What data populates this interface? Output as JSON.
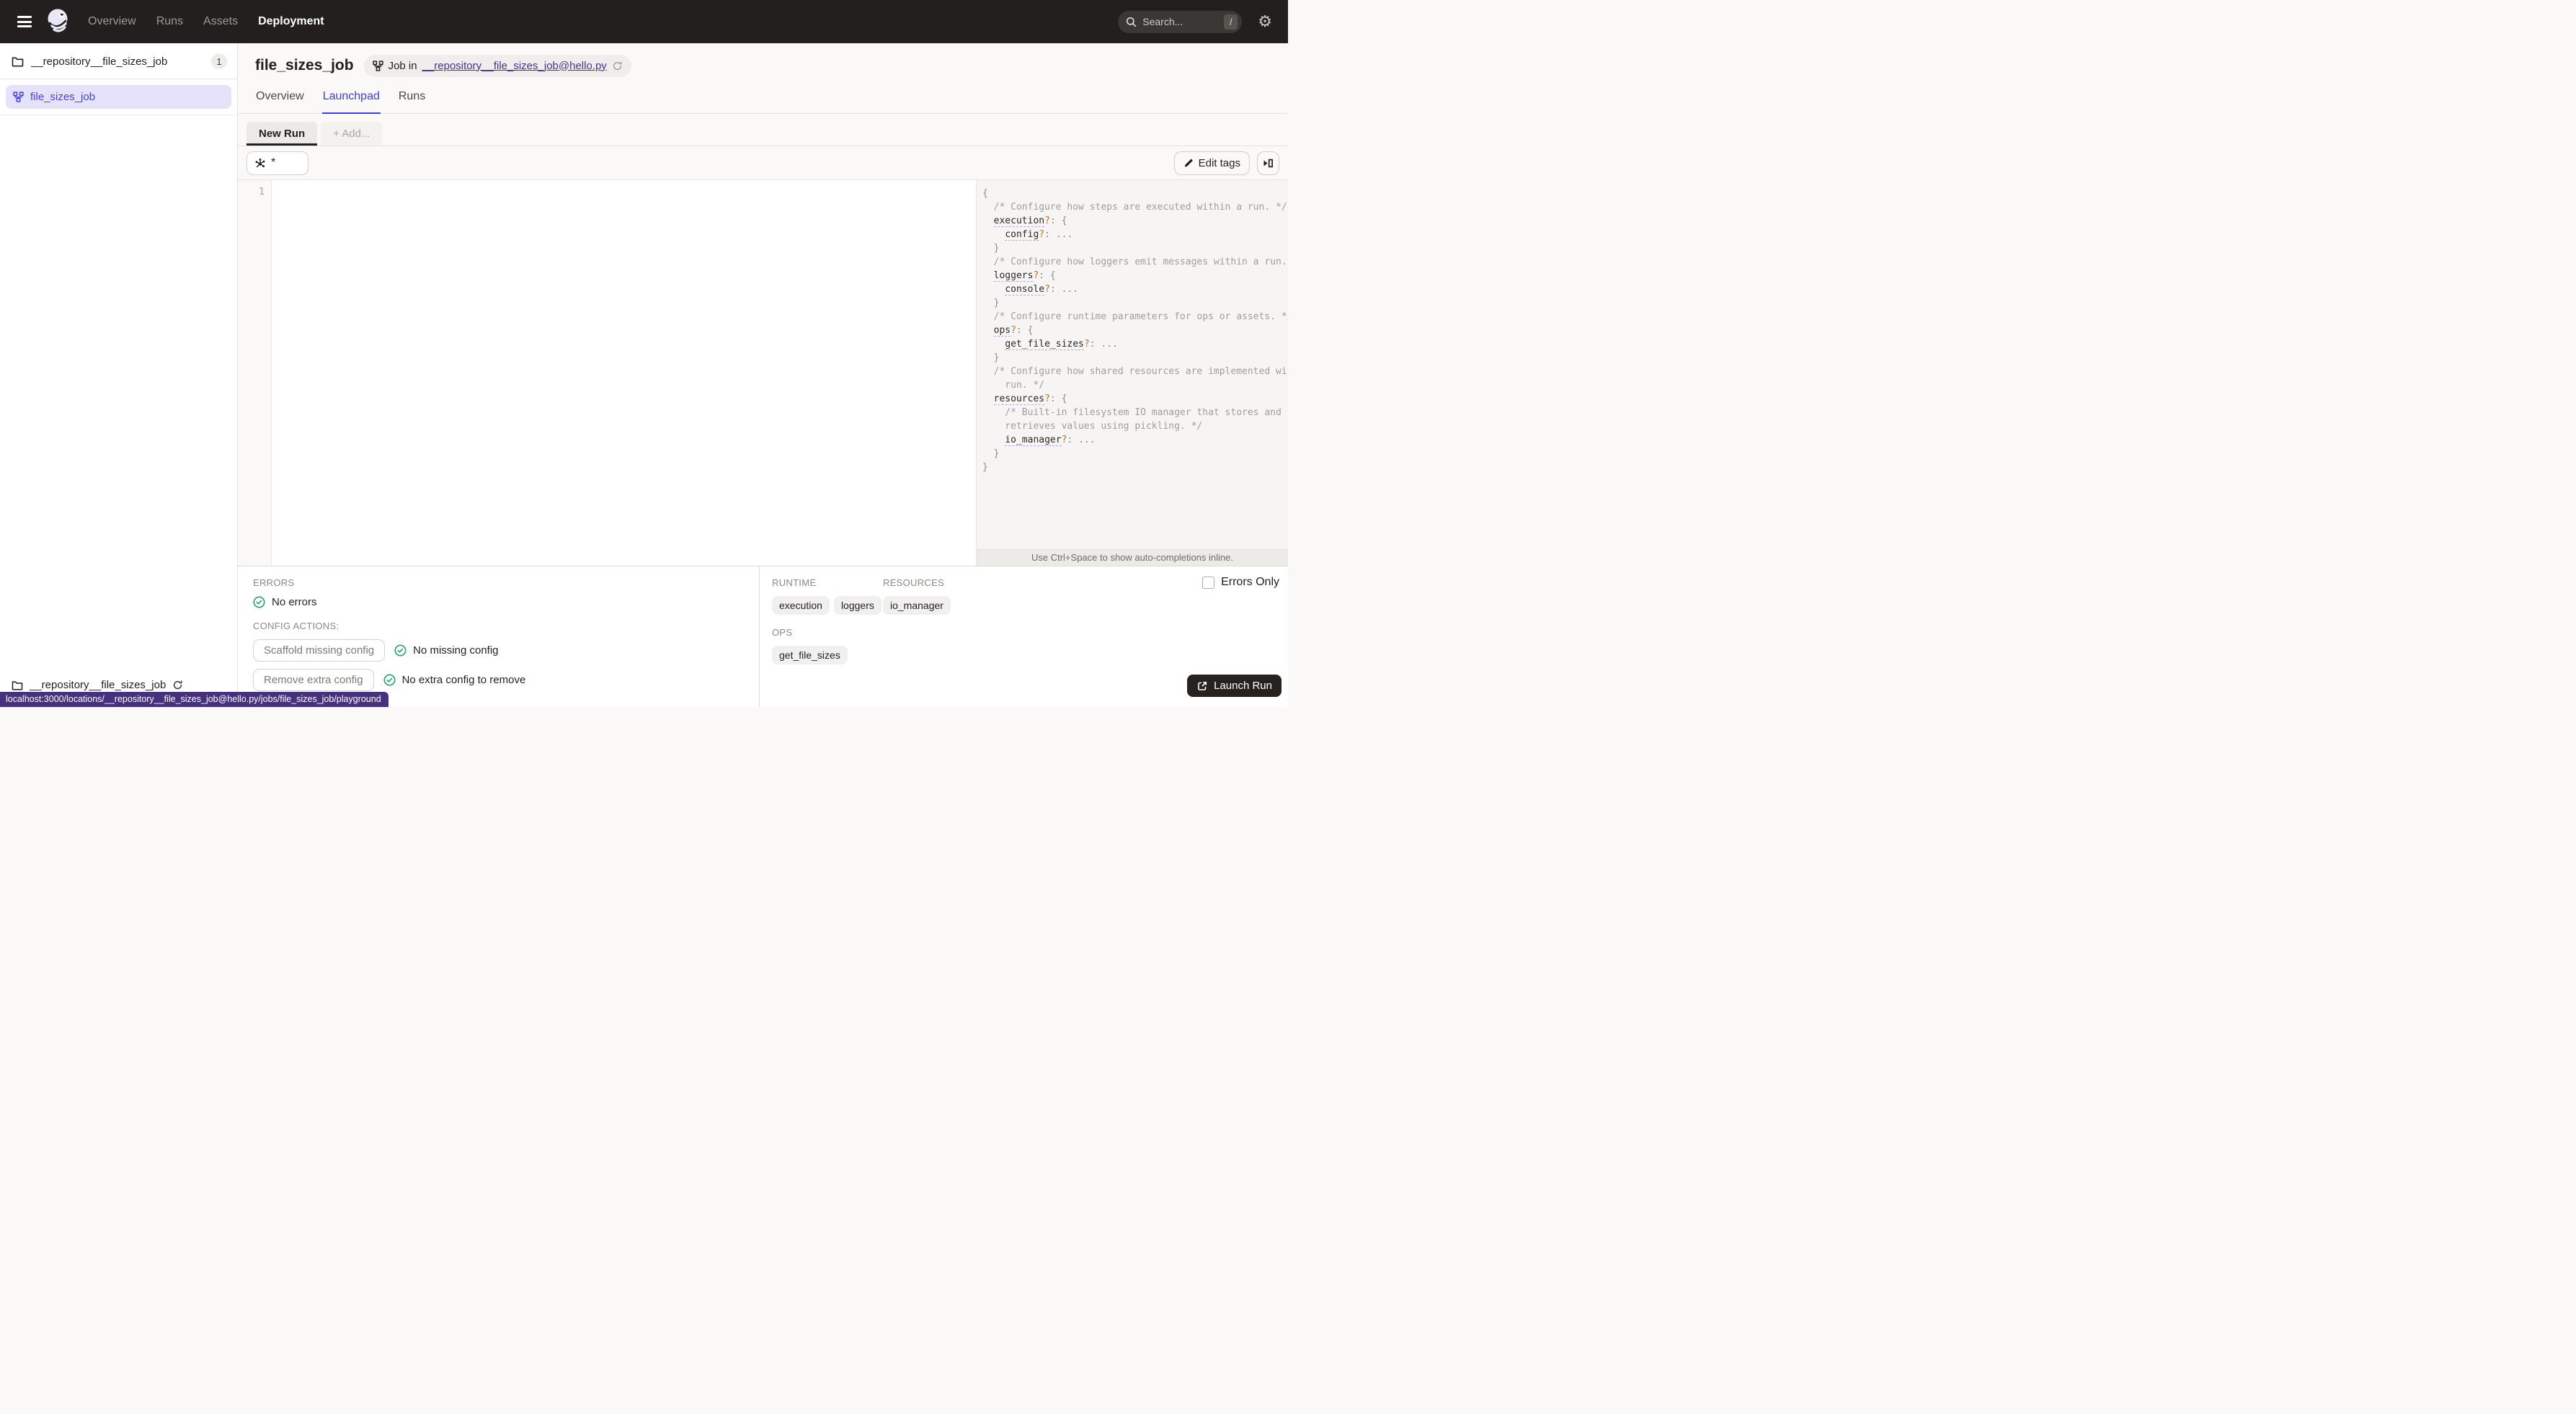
{
  "nav": {
    "items": [
      {
        "label": "Overview",
        "active": false
      },
      {
        "label": "Runs",
        "active": false
      },
      {
        "label": "Assets",
        "active": false
      },
      {
        "label": "Deployment",
        "active": true
      }
    ],
    "search_placeholder": "Search...",
    "search_shortcut": "/"
  },
  "sidebar": {
    "repo_header": {
      "name": "__repository__file_sizes_job",
      "count": "1"
    },
    "items": [
      {
        "label": "file_sizes_job",
        "selected": true
      }
    ],
    "footer_repo": "__repository__file_sizes_job"
  },
  "header": {
    "title": "file_sizes_job",
    "breadcrumb_prefix": "Job in",
    "breadcrumb_link": "__repository__file_sizes_job@hello.py"
  },
  "tabs": [
    {
      "label": "Overview",
      "active": false
    },
    {
      "label": "Launchpad",
      "active": true
    },
    {
      "label": "Runs",
      "active": false
    }
  ],
  "launchpad": {
    "session_tabs": [
      {
        "label": "New Run",
        "active": true
      },
      {
        "label": "+ Add...",
        "active": false
      }
    ],
    "op_selector_value": "*",
    "edit_tags_label": "Edit tags",
    "editor_line_number": "1",
    "hint": "Use Ctrl+Space to show auto-completions inline."
  },
  "schema_lines": [
    [
      [
        "p",
        "{"
      ]
    ],
    [
      [
        "cm",
        "  /* Configure how steps are executed within a run. */"
      ]
    ],
    [
      [
        "p",
        "  "
      ],
      [
        "key",
        "execution"
      ],
      [
        "q",
        "?"
      ],
      [
        "p",
        ": {"
      ]
    ],
    [
      [
        "p",
        "    "
      ],
      [
        "key",
        "config"
      ],
      [
        "q",
        "?"
      ],
      [
        "p",
        ": ..."
      ]
    ],
    [
      [
        "p",
        "  }"
      ]
    ],
    [
      [
        "cm",
        "  /* Configure how loggers emit messages within a run. */"
      ]
    ],
    [
      [
        "p",
        "  "
      ],
      [
        "key",
        "loggers"
      ],
      [
        "q",
        "?"
      ],
      [
        "p",
        ": {"
      ]
    ],
    [
      [
        "p",
        "    "
      ],
      [
        "key",
        "console"
      ],
      [
        "q",
        "?"
      ],
      [
        "p",
        ": ..."
      ]
    ],
    [
      [
        "p",
        "  }"
      ]
    ],
    [
      [
        "cm",
        "  /* Configure runtime parameters for ops or assets. */"
      ]
    ],
    [
      [
        "p",
        "  "
      ],
      [
        "key",
        "ops"
      ],
      [
        "q",
        "?"
      ],
      [
        "p",
        ": {"
      ]
    ],
    [
      [
        "p",
        "    "
      ],
      [
        "key",
        "get_file_sizes"
      ],
      [
        "q",
        "?"
      ],
      [
        "p",
        ": ..."
      ]
    ],
    [
      [
        "p",
        "  }"
      ]
    ],
    [
      [
        "cm",
        "  /* Configure how shared resources are implemented within a"
      ]
    ],
    [
      [
        "cm",
        "    run. */"
      ]
    ],
    [
      [
        "p",
        "  "
      ],
      [
        "key",
        "resources"
      ],
      [
        "q",
        "?"
      ],
      [
        "p",
        ": {"
      ]
    ],
    [
      [
        "cm",
        "    /* Built-in filesystem IO manager that stores and"
      ]
    ],
    [
      [
        "cm",
        "    retrieves values using pickling. */"
      ]
    ],
    [
      [
        "p",
        "    "
      ],
      [
        "key",
        "io_manager"
      ],
      [
        "q",
        "?"
      ],
      [
        "p",
        ": ..."
      ]
    ],
    [
      [
        "p",
        "  }"
      ]
    ],
    [
      [
        "p",
        "}"
      ]
    ]
  ],
  "bottom": {
    "errors_label": "ERRORS",
    "no_errors": "No errors",
    "config_actions_label": "CONFIG ACTIONS:",
    "scaffold_button": "Scaffold missing config",
    "no_missing_config": "No missing config",
    "remove_button": "Remove extra config",
    "no_extra_config": "No extra config to remove",
    "runtime_label": "RUNTIME",
    "runtime_tags": [
      "execution",
      "loggers"
    ],
    "resources_label": "RESOURCES",
    "resource_tags": [
      "io_manager"
    ],
    "ops_label": "OPS",
    "op_tags": [
      "get_file_sizes"
    ],
    "errors_only_label": "Errors Only",
    "launch_button": "Launch Run"
  },
  "status_bar": {
    "url": "localhost:3000/locations/__repository__file_sizes_job@hello.py/jobs/file_sizes_job/playground"
  },
  "colors": {
    "topnav_bg": "#231f1e",
    "accent_tab": "#3f3fe0",
    "selected_item_bg": "#e5e2fa",
    "selected_item_text": "#4645e0",
    "link_purple": "#473293",
    "success_green": "#23a26d",
    "schema_optional_orange": "#bf7326",
    "status_tip_bg": "#46317e"
  }
}
